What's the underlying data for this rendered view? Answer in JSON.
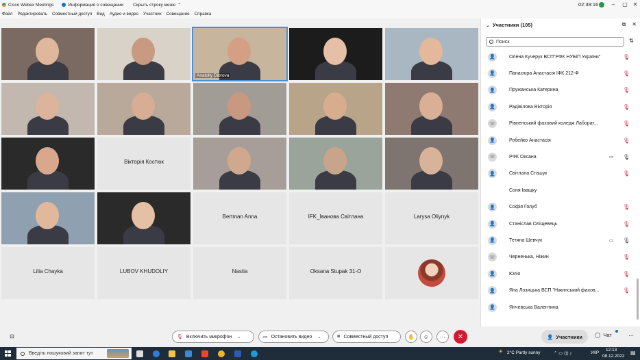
{
  "app": {
    "title": "Cisco Webex Meetings",
    "meeting_info": "Информация о совещании",
    "hide_menu": "Скрыть строку меню",
    "timer": "02:39:16"
  },
  "menu": [
    "Файл",
    "Редактировать",
    "Совместный доступ",
    "Вид",
    "Аудио и видео",
    "Участник",
    "Совещание",
    "Справка"
  ],
  "tiles": [
    {
      "label": "",
      "video": true,
      "bg": "#7a6a62",
      "skin": "#e0b79a"
    },
    {
      "label": "",
      "video": true,
      "bg": "#d8d2c8",
      "skin": "#c89a80"
    },
    {
      "label": "Anatoliy Dibrova",
      "video": true,
      "bg": "#c7b59e",
      "skin": "#d49f82",
      "active": true
    },
    {
      "label": "",
      "video": true,
      "bg": "#1c1c1c",
      "skin": "#e6c0a6"
    },
    {
      "label": "",
      "video": true,
      "bg": "#a8b7c2",
      "skin": "#e4b89a"
    },
    {
      "label": "",
      "video": true,
      "bg": "#c2b8b0",
      "skin": "#dcb39b"
    },
    {
      "label": "",
      "video": true,
      "bg": "#b8a99a",
      "skin": "#d7ad94"
    },
    {
      "label": "",
      "video": true,
      "bg": "#a29c96",
      "skin": "#c89880"
    },
    {
      "label": "",
      "video": true,
      "bg": "#b7a489",
      "skin": "#d8ad8e"
    },
    {
      "label": "",
      "video": true,
      "bg": "#8f7a72",
      "skin": "#d9b096"
    },
    {
      "label": "",
      "video": true,
      "bg": "#2a2a2a",
      "skin": "#d9a88c"
    },
    {
      "label": "Вікторія Костюк",
      "video": false
    },
    {
      "label": "",
      "video": true,
      "bg": "#a79e9a",
      "skin": "#d0a88e"
    },
    {
      "label": "",
      "video": true,
      "bg": "#9aa49a",
      "skin": "#c8a48a"
    },
    {
      "label": "",
      "video": true,
      "bg": "#7f7570",
      "skin": "#d9b29a"
    },
    {
      "label": "",
      "video": true,
      "bg": "#8fa0b0",
      "skin": "#e1b89b"
    },
    {
      "label": "",
      "video": true,
      "bg": "#2a2a2a",
      "skin": "#e6c0a5"
    },
    {
      "label": "Bertman Anna",
      "video": false
    },
    {
      "label": "IFK_Іванова Світлана",
      "video": false
    },
    {
      "label": "Larysa Oliynyk",
      "video": false
    },
    {
      "label": "Lilia Chayka",
      "video": false
    },
    {
      "label": "LUBOV KHUDOLIY",
      "video": false
    },
    {
      "label": "Nastia",
      "video": false
    },
    {
      "label": "Oksana Stupak 31-O",
      "video": false
    },
    {
      "label": "",
      "video": false,
      "avatar": true
    }
  ],
  "panel": {
    "title": "Участники (105)",
    "search_placeholder": "Поиск",
    "participants": [
      {
        "name": "Олена Кучерук ВСП\"РФК НУБіП України\"",
        "cam": false,
        "muted": true
      },
      {
        "name": "Панасюра Анастасія ІФК 212-Ф",
        "cam": false,
        "muted": true
      },
      {
        "name": "Пружанська Катерина",
        "cam": false,
        "muted": true
      },
      {
        "name": "Радівілова Вікторія",
        "cam": false,
        "muted": true
      },
      {
        "name": "Рівненський фаховий коледж Лаборат...",
        "cam": false,
        "muted": true,
        "phone": true
      },
      {
        "name": "Робейко Анастасія",
        "cam": false,
        "muted": true
      },
      {
        "name": "РФК Оксана",
        "cam": true,
        "muted": false,
        "phone": true
      },
      {
        "name": "Світлана Сташук",
        "cam": false,
        "muted": true
      },
      {
        "name": "Соня Іващку",
        "cam": false,
        "muted": false,
        "noav": true
      },
      {
        "name": "Софія Голуб",
        "cam": false,
        "muted": true
      },
      {
        "name": "Станіслав Оліщевець",
        "cam": false,
        "muted": true
      },
      {
        "name": "Тетяна Шевчук",
        "cam": true,
        "muted": false
      },
      {
        "name": "Черненька, Ніжин",
        "cam": false,
        "muted": true,
        "phone": true
      },
      {
        "name": "Юлія",
        "cam": false,
        "muted": true
      },
      {
        "name": "Яна Лозицька ВСП \"Ніжинський фахов...",
        "cam": false,
        "muted": true
      },
      {
        "name": "Янчевська Валентина",
        "cam": false,
        "muted": false
      }
    ]
  },
  "controls": {
    "mic": "Включить микрофон",
    "video": "Остановить видео",
    "share": "Совместный доступ",
    "participants": "Участники",
    "chat": "Чат"
  },
  "taskbar": {
    "search": "Введіть пошуковий запит тут",
    "weather": "2°C  Partly sunny",
    "lang": "УКР",
    "time": "12:13",
    "date": "08.12.2022"
  }
}
